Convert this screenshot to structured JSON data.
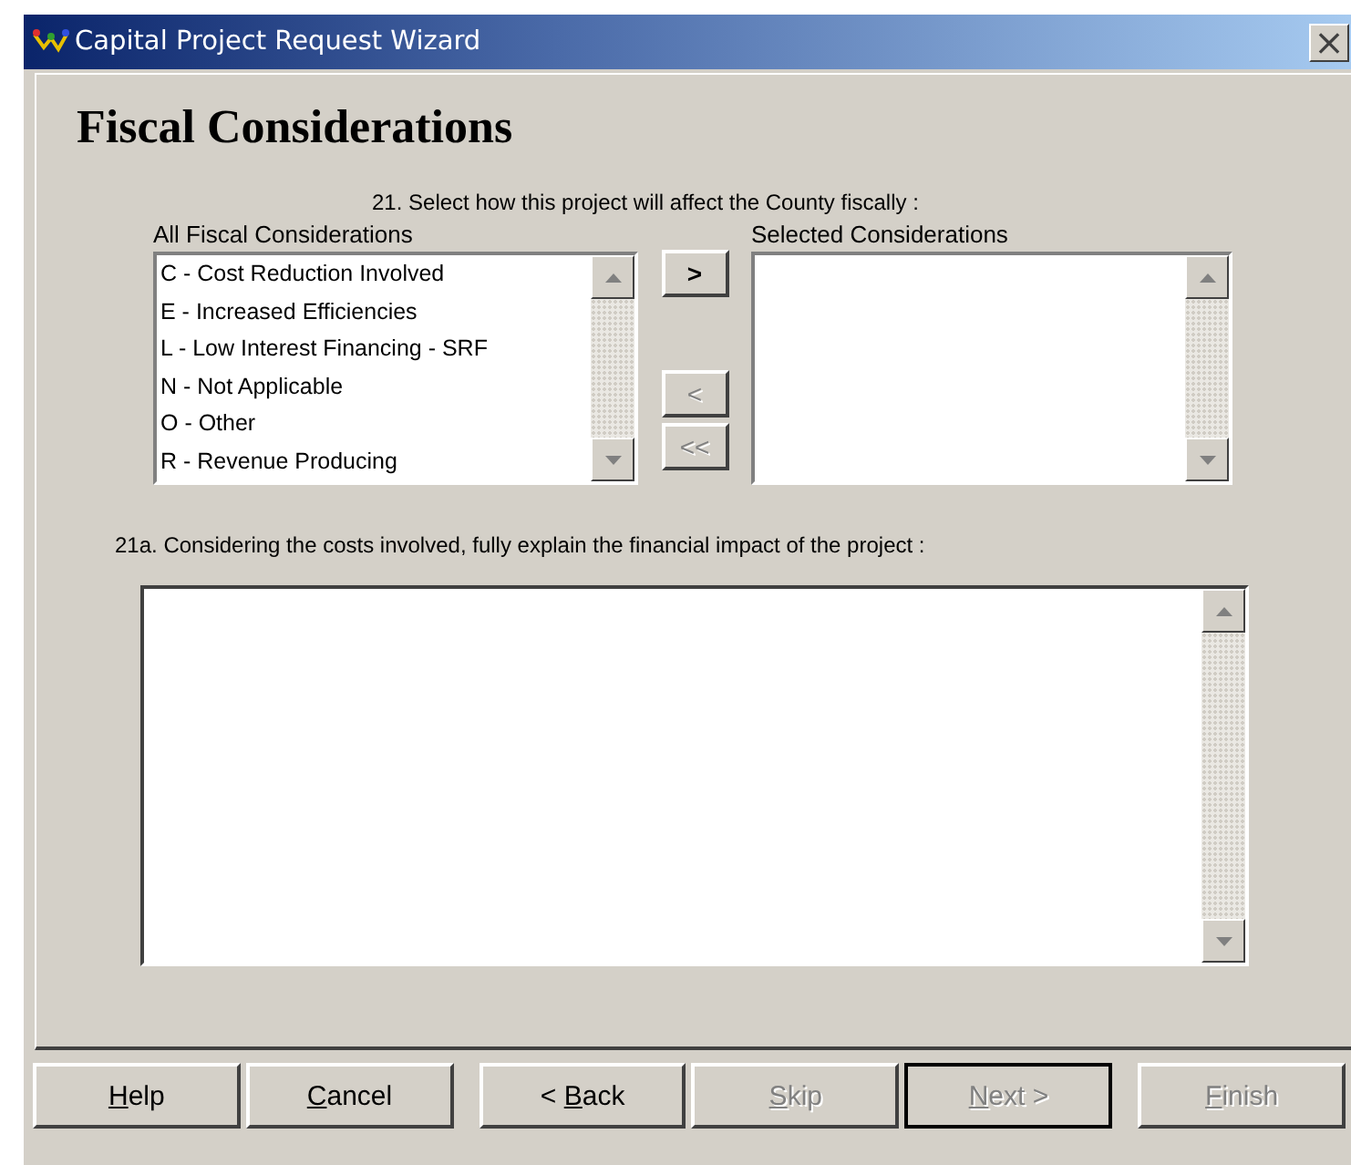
{
  "window": {
    "title": "Capital Project Request Wizard",
    "close": "×"
  },
  "heading": "Fiscal Considerations",
  "question": "21. Select how this project will affect the County fiscally :",
  "available": {
    "label": "All Fiscal Considerations",
    "items": [
      {
        "text": "C - Cost Reduction Involved",
        "selected": false
      },
      {
        "text": "E - Increased Efficiencies",
        "selected": false
      },
      {
        "text": "L - Low Interest Financing - SRF",
        "selected": false
      },
      {
        "text": "N - Not Applicable",
        "selected": false
      },
      {
        "text": "O - Other",
        "selected": false
      },
      {
        "text": "R - Revenue Producing",
        "selected": false
      }
    ]
  },
  "move_buttons": [
    {
      "text": ">",
      "disabled": false
    },
    {
      "text": "<",
      "disabled": true
    },
    {
      "text": "<<",
      "disabled": true
    }
  ],
  "selected_list": {
    "label": "Selected Considerations"
  },
  "explain": {
    "label": "21a. Considering the costs involved, fully explain the financial impact of the project :"
  },
  "buttons": [
    {
      "key": "H",
      "after": "elp",
      "disabled": false,
      "default": false
    },
    {
      "key": "C",
      "after": "ancel",
      "disabled": false,
      "default": false
    },
    {
      "before": "< ",
      "key": "B",
      "after": "ack",
      "disabled": false,
      "default": false
    },
    {
      "key": "S",
      "after": "kip",
      "disabled": true,
      "default": false
    },
    {
      "key": "N",
      "after": "ext  >",
      "disabled": true,
      "default": true
    },
    {
      "key": "F",
      "after": "inish",
      "disabled": true,
      "default": false
    }
  ]
}
